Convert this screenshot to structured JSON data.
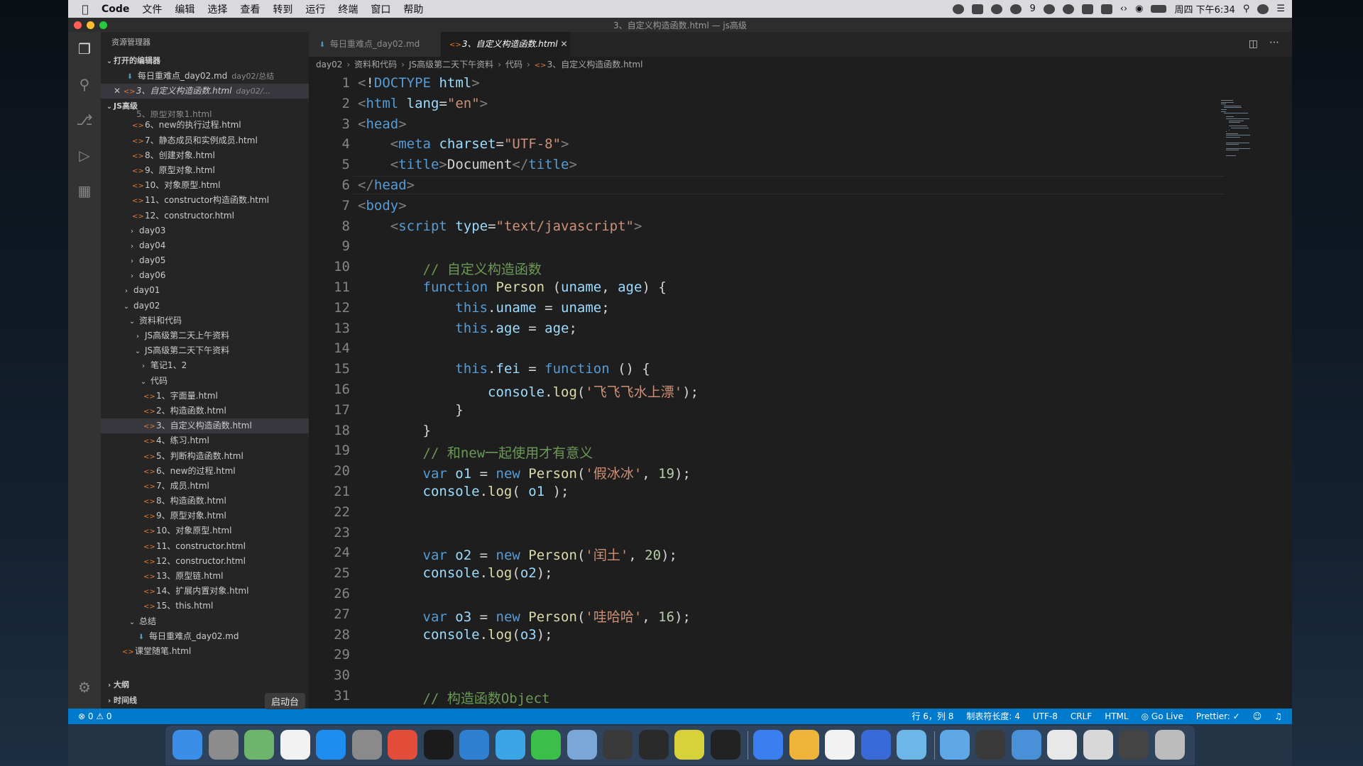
{
  "menubar": {
    "app": "Code",
    "items": [
      "文件",
      "编辑",
      "选择",
      "查看",
      "转到",
      "运行",
      "终端",
      "窗口",
      "帮助"
    ],
    "wechat_badge": "9",
    "datetime": "周四 下午6:34"
  },
  "window": {
    "title": "3、自定义构造函数.html — js高级"
  },
  "sidebar": {
    "title": "资源管理器",
    "open_editors": {
      "label": "打开的编辑器",
      "items": [
        {
          "name": "每日重难点_day02.md",
          "desc": "day02/总结"
        },
        {
          "name": "3、自定义构造函数.html",
          "desc": "day02/..."
        }
      ]
    },
    "workspace": {
      "label": "JS高级",
      "partial": "5、原型对象1.html",
      "items": [
        "6、new的执行过程.html",
        "7、静态成员和实例成员.html",
        "8、创建对象.html",
        "9、原型对象.html",
        "10、对象原型.html",
        "11、constructor构造函数.html",
        "12、constructor.html",
        "day03",
        "day04",
        "day05",
        "day06",
        "day01",
        "day02",
        "资料和代码",
        "JS高级第二天上午资料",
        "JS高级第二天下午资料",
        "笔记1、2",
        "代码",
        "1、字面量.html",
        "2、构造函数.html",
        "3、自定义构造函数.html",
        "4、练习.html",
        "5、判断构造函数.html",
        "6、new的过程.html",
        "7、成员.html",
        "8、构造函数.html",
        "9、原型对象.html",
        "10、对象原型.html",
        "11、constructor.html",
        "12、constructor.html",
        "13、原型链.html",
        "14、扩展内置对象.html",
        "15、this.html",
        "总结",
        "每日重难点_day02.md",
        "课堂随笔.html"
      ]
    },
    "outline": "大纲",
    "timeline": "时间线",
    "tooltip": "启动台"
  },
  "editor": {
    "tabs": [
      {
        "label": "每日重难点_day02.md"
      },
      {
        "label": "3、自定义构造函数.html"
      }
    ],
    "breadcrumb": [
      "day02",
      "资料和代码",
      "JS高级第二天下午资料",
      "代码",
      "3、自定义构造函数.html"
    ],
    "lines": [
      "<!DOCTYPE html>",
      "<html lang=\"en\">",
      "<head>",
      "    <meta charset=\"UTF-8\">",
      "    <title>Document</title>",
      "</head>",
      "<body>",
      "    <script type=\"text/javascript\">",
      "",
      "        // 自定义构造函数",
      "        function Person (uname, age) {",
      "            this.uname = uname;",
      "            this.age = age;",
      "",
      "            this.fei = function () {",
      "                console.log('飞飞飞水上漂');",
      "            }",
      "        }",
      "        // 和new一起使用才有意义",
      "        var o1 = new Person('假冰冰', 19);",
      "        console.log( o1 );",
      "",
      "",
      "        var o2 = new Person('闰土', 20);",
      "        console.log(o2);",
      "",
      "        var o3 = new Person('哇哈哈', 16);",
      "        console.log(o3);",
      "",
      "",
      "        // 构造函数Object"
    ]
  },
  "statusbar": {
    "problems": "⊗ 0 ⚠ 0",
    "position": "行 6，列 8",
    "tab_size": "制表符长度: 4",
    "encoding": "UTF-8",
    "eol": "CRLF",
    "language": "HTML",
    "go_live": "Go Live",
    "prettier": "Prettier: ✓"
  },
  "colors": {
    "statusbar": "#007acc",
    "sidebar": "#252526",
    "editor": "#1e1e1e",
    "activitybar": "#333333"
  }
}
